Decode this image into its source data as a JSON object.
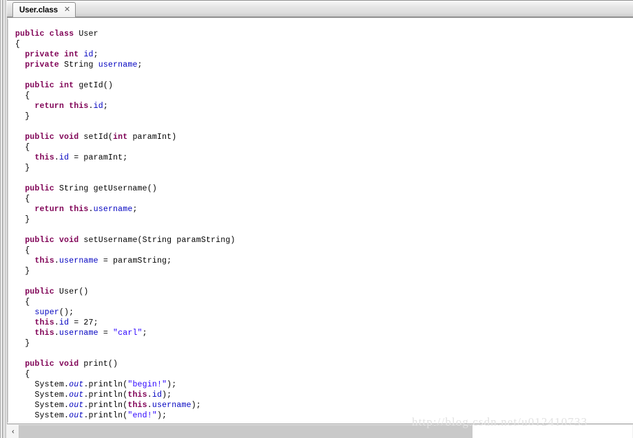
{
  "window": {
    "title": "User.class"
  },
  "tab_bar": {
    "tabs": [
      {
        "label": "User.class",
        "close_glyph": "✕",
        "active": true
      }
    ]
  },
  "editor": {
    "language": "java",
    "file_name": "User.class",
    "lines": [
      {
        "n": 1,
        "tokens": [
          {
            "t": "public",
            "c": "kw"
          },
          {
            "t": " ",
            "c": "plain"
          },
          {
            "t": "class",
            "c": "kw"
          },
          {
            "t": " User",
            "c": "plain"
          }
        ]
      },
      {
        "n": 2,
        "tokens": [
          {
            "t": "{",
            "c": "plain"
          }
        ]
      },
      {
        "n": 3,
        "tokens": [
          {
            "t": "  ",
            "c": "plain"
          },
          {
            "t": "private",
            "c": "kw"
          },
          {
            "t": " ",
            "c": "plain"
          },
          {
            "t": "int",
            "c": "kw"
          },
          {
            "t": " ",
            "c": "plain"
          },
          {
            "t": "id",
            "c": "field"
          },
          {
            "t": ";",
            "c": "plain"
          }
        ]
      },
      {
        "n": 4,
        "tokens": [
          {
            "t": "  ",
            "c": "plain"
          },
          {
            "t": "private",
            "c": "kw"
          },
          {
            "t": " String ",
            "c": "plain"
          },
          {
            "t": "username",
            "c": "field"
          },
          {
            "t": ";",
            "c": "plain"
          }
        ]
      },
      {
        "n": 5,
        "tokens": [
          {
            "t": "",
            "c": "plain"
          }
        ]
      },
      {
        "n": 6,
        "tokens": [
          {
            "t": "  ",
            "c": "plain"
          },
          {
            "t": "public",
            "c": "kw"
          },
          {
            "t": " ",
            "c": "plain"
          },
          {
            "t": "int",
            "c": "kw"
          },
          {
            "t": " getId()",
            "c": "plain"
          }
        ]
      },
      {
        "n": 7,
        "tokens": [
          {
            "t": "  {",
            "c": "plain"
          }
        ]
      },
      {
        "n": 8,
        "tokens": [
          {
            "t": "    ",
            "c": "plain"
          },
          {
            "t": "return",
            "c": "kw"
          },
          {
            "t": " ",
            "c": "plain"
          },
          {
            "t": "this",
            "c": "kw"
          },
          {
            "t": ".",
            "c": "plain"
          },
          {
            "t": "id",
            "c": "field"
          },
          {
            "t": ";",
            "c": "plain"
          }
        ]
      },
      {
        "n": 9,
        "tokens": [
          {
            "t": "  }",
            "c": "plain"
          }
        ]
      },
      {
        "n": 10,
        "tokens": [
          {
            "t": "",
            "c": "plain"
          }
        ]
      },
      {
        "n": 11,
        "tokens": [
          {
            "t": "  ",
            "c": "plain"
          },
          {
            "t": "public",
            "c": "kw"
          },
          {
            "t": " ",
            "c": "plain"
          },
          {
            "t": "void",
            "c": "kw"
          },
          {
            "t": " setId(",
            "c": "plain"
          },
          {
            "t": "int",
            "c": "kw"
          },
          {
            "t": " paramInt)",
            "c": "plain"
          }
        ]
      },
      {
        "n": 12,
        "tokens": [
          {
            "t": "  {",
            "c": "plain"
          }
        ]
      },
      {
        "n": 13,
        "tokens": [
          {
            "t": "    ",
            "c": "plain"
          },
          {
            "t": "this",
            "c": "kw"
          },
          {
            "t": ".",
            "c": "plain"
          },
          {
            "t": "id",
            "c": "field"
          },
          {
            "t": " = paramInt;",
            "c": "plain"
          }
        ]
      },
      {
        "n": 14,
        "tokens": [
          {
            "t": "  }",
            "c": "plain"
          }
        ]
      },
      {
        "n": 15,
        "tokens": [
          {
            "t": "",
            "c": "plain"
          }
        ]
      },
      {
        "n": 16,
        "tokens": [
          {
            "t": "  ",
            "c": "plain"
          },
          {
            "t": "public",
            "c": "kw"
          },
          {
            "t": " String getUsername()",
            "c": "plain"
          }
        ]
      },
      {
        "n": 17,
        "tokens": [
          {
            "t": "  {",
            "c": "plain"
          }
        ]
      },
      {
        "n": 18,
        "tokens": [
          {
            "t": "    ",
            "c": "plain"
          },
          {
            "t": "return",
            "c": "kw"
          },
          {
            "t": " ",
            "c": "plain"
          },
          {
            "t": "this",
            "c": "kw"
          },
          {
            "t": ".",
            "c": "plain"
          },
          {
            "t": "username",
            "c": "field"
          },
          {
            "t": ";",
            "c": "plain"
          }
        ]
      },
      {
        "n": 19,
        "tokens": [
          {
            "t": "  }",
            "c": "plain"
          }
        ]
      },
      {
        "n": 20,
        "tokens": [
          {
            "t": "",
            "c": "plain"
          }
        ]
      },
      {
        "n": 21,
        "tokens": [
          {
            "t": "  ",
            "c": "plain"
          },
          {
            "t": "public",
            "c": "kw"
          },
          {
            "t": " ",
            "c": "plain"
          },
          {
            "t": "void",
            "c": "kw"
          },
          {
            "t": " setUsername(String paramString)",
            "c": "plain"
          }
        ]
      },
      {
        "n": 22,
        "tokens": [
          {
            "t": "  {",
            "c": "plain"
          }
        ]
      },
      {
        "n": 23,
        "tokens": [
          {
            "t": "    ",
            "c": "plain"
          },
          {
            "t": "this",
            "c": "kw"
          },
          {
            "t": ".",
            "c": "plain"
          },
          {
            "t": "username",
            "c": "field"
          },
          {
            "t": " = paramString;",
            "c": "plain"
          }
        ]
      },
      {
        "n": 24,
        "tokens": [
          {
            "t": "  }",
            "c": "plain"
          }
        ]
      },
      {
        "n": 25,
        "tokens": [
          {
            "t": "",
            "c": "plain"
          }
        ]
      },
      {
        "n": 26,
        "tokens": [
          {
            "t": "  ",
            "c": "plain"
          },
          {
            "t": "public",
            "c": "kw"
          },
          {
            "t": " User()",
            "c": "plain"
          }
        ]
      },
      {
        "n": 27,
        "tokens": [
          {
            "t": "  {",
            "c": "plain"
          }
        ]
      },
      {
        "n": 28,
        "tokens": [
          {
            "t": "    ",
            "c": "plain"
          },
          {
            "t": "super",
            "c": "field"
          },
          {
            "t": "();",
            "c": "plain"
          }
        ]
      },
      {
        "n": 29,
        "tokens": [
          {
            "t": "    ",
            "c": "plain"
          },
          {
            "t": "this",
            "c": "kw"
          },
          {
            "t": ".",
            "c": "plain"
          },
          {
            "t": "id",
            "c": "field"
          },
          {
            "t": " = 27;",
            "c": "plain"
          }
        ]
      },
      {
        "n": 30,
        "tokens": [
          {
            "t": "    ",
            "c": "plain"
          },
          {
            "t": "this",
            "c": "kw"
          },
          {
            "t": ".",
            "c": "plain"
          },
          {
            "t": "username",
            "c": "field"
          },
          {
            "t": " = ",
            "c": "plain"
          },
          {
            "t": "\"carl\"",
            "c": "str"
          },
          {
            "t": ";",
            "c": "plain"
          }
        ]
      },
      {
        "n": 31,
        "tokens": [
          {
            "t": "  }",
            "c": "plain"
          }
        ]
      },
      {
        "n": 32,
        "tokens": [
          {
            "t": "",
            "c": "plain"
          }
        ]
      },
      {
        "n": 33,
        "tokens": [
          {
            "t": "  ",
            "c": "plain"
          },
          {
            "t": "public",
            "c": "kw"
          },
          {
            "t": " ",
            "c": "plain"
          },
          {
            "t": "void",
            "c": "kw"
          },
          {
            "t": " print()",
            "c": "plain"
          }
        ]
      },
      {
        "n": 34,
        "tokens": [
          {
            "t": "  {",
            "c": "plain"
          }
        ]
      },
      {
        "n": 35,
        "tokens": [
          {
            "t": "    System.",
            "c": "plain"
          },
          {
            "t": "out",
            "c": "static"
          },
          {
            "t": ".println(",
            "c": "plain"
          },
          {
            "t": "\"begin!\"",
            "c": "str"
          },
          {
            "t": ");",
            "c": "plain"
          }
        ]
      },
      {
        "n": 36,
        "tokens": [
          {
            "t": "    System.",
            "c": "plain"
          },
          {
            "t": "out",
            "c": "static"
          },
          {
            "t": ".println(",
            "c": "plain"
          },
          {
            "t": "this",
            "c": "kw"
          },
          {
            "t": ".",
            "c": "plain"
          },
          {
            "t": "id",
            "c": "field"
          },
          {
            "t": ");",
            "c": "plain"
          }
        ]
      },
      {
        "n": 37,
        "tokens": [
          {
            "t": "    System.",
            "c": "plain"
          },
          {
            "t": "out",
            "c": "static"
          },
          {
            "t": ".println(",
            "c": "plain"
          },
          {
            "t": "this",
            "c": "kw"
          },
          {
            "t": ".",
            "c": "plain"
          },
          {
            "t": "username",
            "c": "field"
          },
          {
            "t": ");",
            "c": "plain"
          }
        ]
      },
      {
        "n": 38,
        "tokens": [
          {
            "t": "    System.",
            "c": "plain"
          },
          {
            "t": "out",
            "c": "static"
          },
          {
            "t": ".println(",
            "c": "plain"
          },
          {
            "t": "\"end!\"",
            "c": "str"
          },
          {
            "t": ");",
            "c": "plain"
          }
        ]
      }
    ]
  },
  "scrollbar": {
    "left_arrow_glyph": "‹",
    "thumb_fraction": 0.74
  },
  "watermark": {
    "text": "http://blog.csdn.net/u012410733"
  },
  "colors": {
    "keyword": "#7f0055",
    "field": "#0000c0",
    "string": "#2a00ff",
    "plain": "#000000",
    "editor_bg": "#ffffff",
    "chrome": "#e6e6e6",
    "scroll_thumb": "#c9c9c9",
    "watermark": "#e2e2e2"
  }
}
